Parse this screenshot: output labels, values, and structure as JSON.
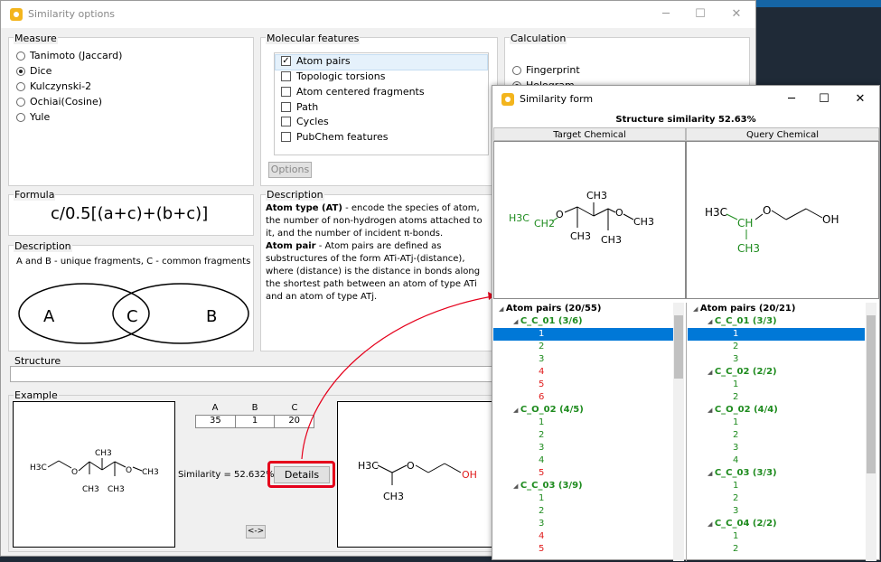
{
  "main": {
    "title": "Similarity options",
    "measure": {
      "label": "Measure",
      "options": [
        "Tanimoto (Jaccard)",
        "Dice",
        "Kulczynski-2",
        "Ochiai(Cosine)",
        "Yule"
      ],
      "selected": "Dice"
    },
    "molecular_features": {
      "label": "Molecular features",
      "items": [
        "Atom pairs",
        "Topologic torsions",
        "Atom centered fragments",
        "Path",
        "Cycles",
        "PubChem features"
      ],
      "checked": [
        "Atom pairs"
      ],
      "options_button": "Options"
    },
    "calculation": {
      "label": "Calculation",
      "options": [
        "Fingerprint",
        "Hologram"
      ],
      "selected": "Hologram"
    },
    "formula": {
      "label": "Formula",
      "text": "c/0.5[(a+c)+(b+c)]"
    },
    "description_left": {
      "label": "Description",
      "text": "A and B - unique fragments, C - common fragments",
      "venn": {
        "a": "A",
        "c": "C",
        "b": "B"
      }
    },
    "description_right": {
      "label": "Description",
      "p1_title": "Atom type (AT)",
      "p1": " - encode the species of atom, the number of non-hydrogen atoms attached to it, and the number of incident π-bonds.",
      "p2_title": "Atom pair",
      "p2": " - Atom pairs are defined as substructures of the form ATi-ATj-(distance), where (distance) is the distance in bonds along the shortest path between an atom of type  ATi and an atom of type ATj."
    },
    "structure": {
      "label": "Structure",
      "value": ""
    },
    "example": {
      "label": "Example",
      "headers": [
        "A",
        "B",
        "C"
      ],
      "values": [
        "35",
        "1",
        "20"
      ],
      "similarity_label": "Similarity  =  52.632%",
      "details_button": "Details",
      "swap_button": "<->"
    }
  },
  "form": {
    "title": "Similarity form",
    "heading": "Structure similarity 52.63%",
    "col_target": "Target Chemical",
    "col_query": "Query Chemical"
  },
  "chem": {
    "h3c": "H3C",
    "ch2": "CH2",
    "o": "O",
    "ch3": "CH3",
    "ch": "CH",
    "oh": "OH"
  },
  "left_tree": [
    {
      "t": "Atom pairs (20/55)",
      "k": "root"
    },
    {
      "t": "C_C_01 (3/6)",
      "k": "group"
    },
    {
      "t": "1",
      "k": "sel"
    },
    {
      "t": "2",
      "k": "g"
    },
    {
      "t": "3",
      "k": "g"
    },
    {
      "t": "4",
      "k": "r"
    },
    {
      "t": "5",
      "k": "r"
    },
    {
      "t": "6",
      "k": "r"
    },
    {
      "t": "C_O_02 (4/5)",
      "k": "group"
    },
    {
      "t": "1",
      "k": "g"
    },
    {
      "t": "2",
      "k": "g"
    },
    {
      "t": "3",
      "k": "g"
    },
    {
      "t": "4",
      "k": "g"
    },
    {
      "t": "5",
      "k": "r"
    },
    {
      "t": "C_C_03 (3/9)",
      "k": "group"
    },
    {
      "t": "1",
      "k": "g"
    },
    {
      "t": "2",
      "k": "g"
    },
    {
      "t": "3",
      "k": "g"
    },
    {
      "t": "4",
      "k": "r"
    },
    {
      "t": "5",
      "k": "r"
    }
  ],
  "right_tree": [
    {
      "t": "Atom pairs (20/21)",
      "k": "root"
    },
    {
      "t": "C_C_01 (3/3)",
      "k": "group"
    },
    {
      "t": "1",
      "k": "sel"
    },
    {
      "t": "2",
      "k": "g"
    },
    {
      "t": "3",
      "k": "g"
    },
    {
      "t": "C_C_02 (2/2)",
      "k": "group"
    },
    {
      "t": "1",
      "k": "g"
    },
    {
      "t": "2",
      "k": "g"
    },
    {
      "t": "C_O_02 (4/4)",
      "k": "group"
    },
    {
      "t": "1",
      "k": "g"
    },
    {
      "t": "2",
      "k": "g"
    },
    {
      "t": "3",
      "k": "g"
    },
    {
      "t": "4",
      "k": "g"
    },
    {
      "t": "C_C_03 (3/3)",
      "k": "group"
    },
    {
      "t": "1",
      "k": "g"
    },
    {
      "t": "2",
      "k": "g"
    },
    {
      "t": "3",
      "k": "g"
    },
    {
      "t": "C_C_04 (2/2)",
      "k": "group"
    },
    {
      "t": "1",
      "k": "g"
    },
    {
      "t": "2",
      "k": "g"
    }
  ]
}
